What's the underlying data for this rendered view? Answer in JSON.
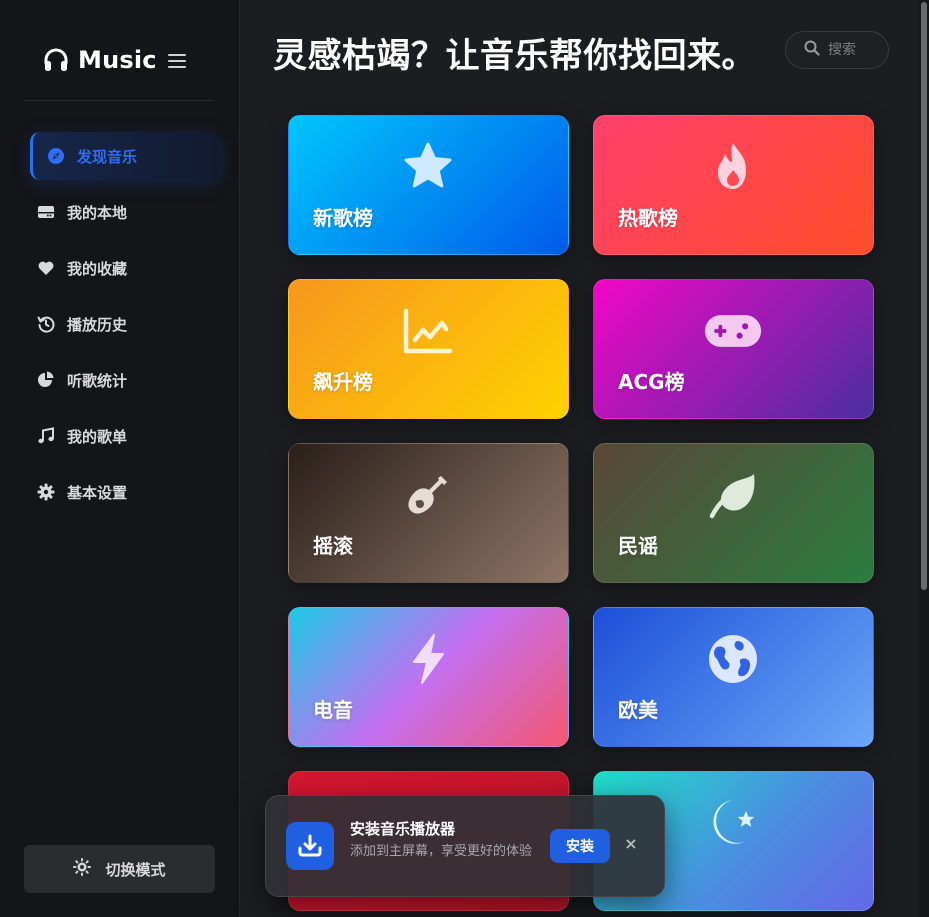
{
  "app": {
    "name": "Music",
    "logo_icon": "headphones-icon",
    "menu_icon": "hamburger-icon"
  },
  "sidebar": {
    "items": [
      {
        "label": "发现音乐",
        "icon": "compass-icon",
        "active": true
      },
      {
        "label": "我的本地",
        "icon": "hard-drive-icon",
        "active": false
      },
      {
        "label": "我的收藏",
        "icon": "heart-icon",
        "active": false
      },
      {
        "label": "播放历史",
        "icon": "history-icon",
        "active": false
      },
      {
        "label": "听歌统计",
        "icon": "pie-chart-icon",
        "active": false
      },
      {
        "label": "我的歌单",
        "icon": "music-note-icon",
        "active": false
      },
      {
        "label": "基本设置",
        "icon": "gear-icon",
        "active": false
      }
    ],
    "mode_button": {
      "label": "切换模式",
      "icon": "sun-icon"
    }
  },
  "main": {
    "headline": "灵感枯竭？让音乐帮你找回来。",
    "search": {
      "placeholder": "搜索",
      "value": ""
    },
    "cards": [
      {
        "label": "新歌榜",
        "icon": "star-icon",
        "colors": [
          "#00c6fb",
          "#005bea"
        ]
      },
      {
        "label": "热歌榜",
        "icon": "fire-icon",
        "colors": [
          "#ff3f6c",
          "#ff4e2a"
        ]
      },
      {
        "label": "飙升榜",
        "icon": "trending-chart-icon",
        "colors": [
          "#f7971e",
          "#ffd200"
        ]
      },
      {
        "label": "ACG榜",
        "icon": "gamepad-icon",
        "colors": [
          "#f107c6",
          "#4a2ea0"
        ]
      },
      {
        "label": "摇滚",
        "icon": "guitar-icon",
        "colors": [
          "#2a1f1a",
          "#8e7566"
        ]
      },
      {
        "label": "民谣",
        "icon": "leaf-icon",
        "colors": [
          "#5a4638",
          "#2a7d3f"
        ]
      },
      {
        "label": "电音",
        "icon": "lightning-icon",
        "colors": [
          "#1cc9e6",
          "#c46ff0",
          "#f55770"
        ]
      },
      {
        "label": "欧美",
        "icon": "globe-icon",
        "colors": [
          "#1d4fd8",
          "#6aa8f8"
        ]
      },
      {
        "label": "",
        "icon": "",
        "colors": [
          "#d6162f",
          "#c0142a"
        ]
      },
      {
        "label": "",
        "icon": "moon-star-icon",
        "colors": [
          "#1de0c8",
          "#4a8ee0",
          "#6468e8"
        ]
      }
    ]
  },
  "install_prompt": {
    "title": "安装音乐播放器",
    "description": "添加到主屏幕，享受更好的体验",
    "install_label": "安装",
    "close_label": "×",
    "icon": "download-icon"
  }
}
